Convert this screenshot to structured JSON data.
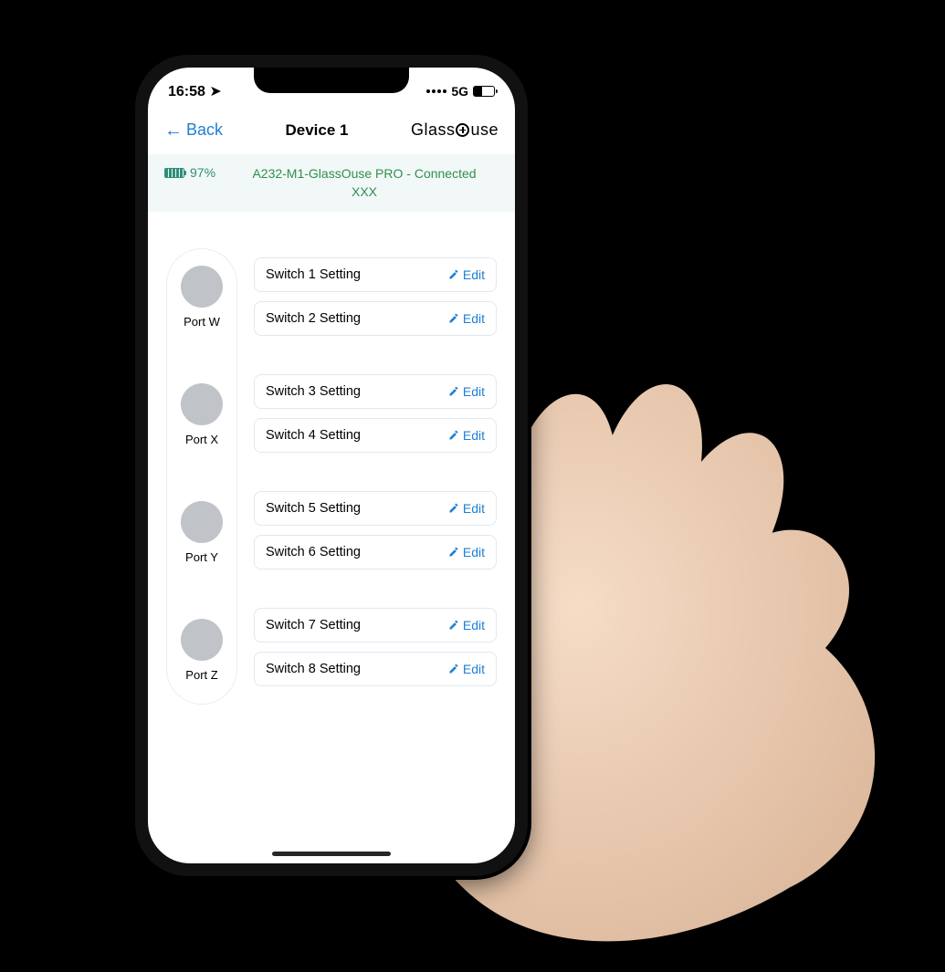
{
  "statusbar": {
    "time": "16:58",
    "network": "5G"
  },
  "nav": {
    "back_label": "Back",
    "title": "Device 1",
    "brand_pre": "Glass",
    "brand_post": "use"
  },
  "device": {
    "battery_pct": "97%",
    "conn_line1": "A232-M1-GlassOuse PRO  - Connected",
    "conn_line2": "XXX"
  },
  "ports": [
    {
      "label": "Port W"
    },
    {
      "label": "Port X"
    },
    {
      "label": "Port Y"
    },
    {
      "label": "Port Z"
    }
  ],
  "switches": {
    "edit_label": "Edit",
    "groups": [
      [
        "Switch 1 Setting",
        "Switch 2 Setting"
      ],
      [
        "Switch 3 Setting",
        "Switch 4 Setting"
      ],
      [
        "Switch 5 Setting",
        "Switch 6 Setting"
      ],
      [
        "Switch 7 Setting",
        "Switch 8 Setting"
      ]
    ]
  }
}
